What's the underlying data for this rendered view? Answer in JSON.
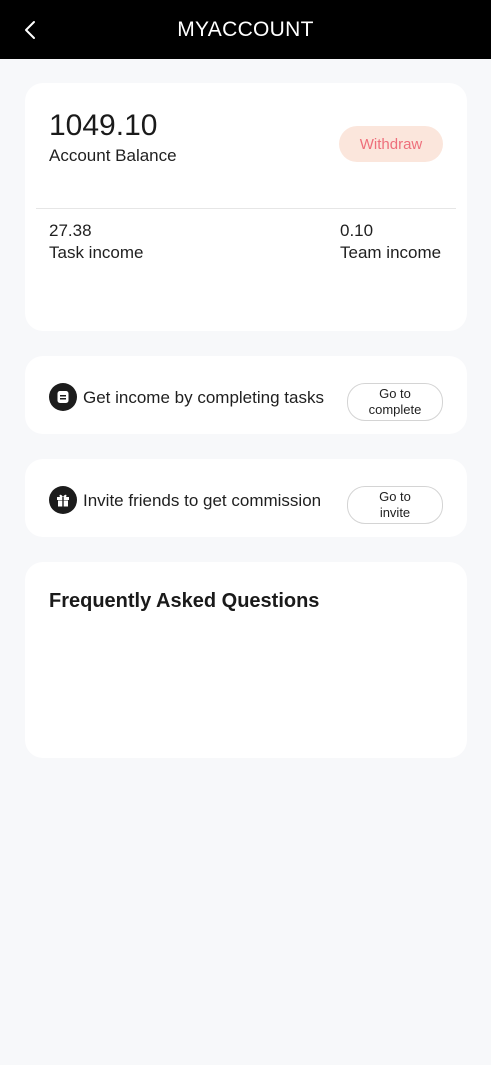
{
  "header": {
    "title": "MYACCOUNT",
    "back_icon": "chevron-left-icon"
  },
  "balance": {
    "value": "1049.10",
    "label": "Account Balance",
    "withdraw_label": "Withdraw",
    "task_income_value": "27.38",
    "task_income_label": "Task income",
    "team_income_value": "0.10",
    "team_income_label": "Team income"
  },
  "task_row": {
    "icon": "task-list-icon",
    "text": "Get income by completing tasks",
    "button_line1": "Go to",
    "button_line2": "complete"
  },
  "invite_row": {
    "icon": "gift-icon",
    "text": "Invite friends to get commission",
    "button_line1": "Go to",
    "button_line2": "invite"
  },
  "faq": {
    "title": "Frequently Asked Questions"
  },
  "colors": {
    "header_bg": "#000000",
    "page_bg": "#f7f8fa",
    "withdraw_bg": "#fbe6dc",
    "withdraw_text": "#ee6f7b"
  }
}
